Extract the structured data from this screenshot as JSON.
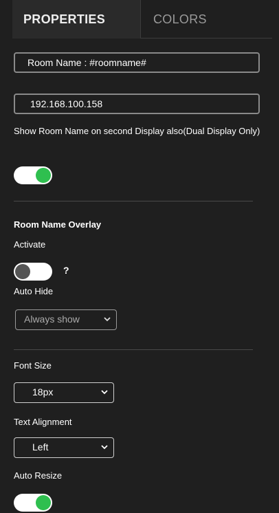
{
  "tabs": [
    {
      "label": "PROPERTIES",
      "active": true
    },
    {
      "label": "COLORS",
      "active": false
    }
  ],
  "room_name_field": {
    "value": "Room Name : #roomname#"
  },
  "ip_field": {
    "value": "192.168.100.158"
  },
  "dual_display": {
    "label": "Show Room Name on second Display also(Dual Display Only)",
    "enabled": true
  },
  "overlay": {
    "heading": "Room Name Overlay",
    "activate_label": "Activate",
    "activate_enabled": false,
    "help_symbol": "?",
    "auto_hide_label": "Auto Hide",
    "auto_hide_value": "Always show"
  },
  "text_settings": {
    "font_size_label": "Font Size",
    "font_size_value": "18px",
    "text_alignment_label": "Text Alignment",
    "text_alignment_value": "Left",
    "auto_resize_label": "Auto Resize",
    "auto_resize_enabled": true
  },
  "icons": {
    "dropdown": "chevron-down-icon",
    "help": "question-icon"
  },
  "colors": {
    "background": "#1f1f1f",
    "active_tab": "#2a2a2a",
    "toggle_on": "#2fbf4f",
    "toggle_off": "#555555"
  }
}
